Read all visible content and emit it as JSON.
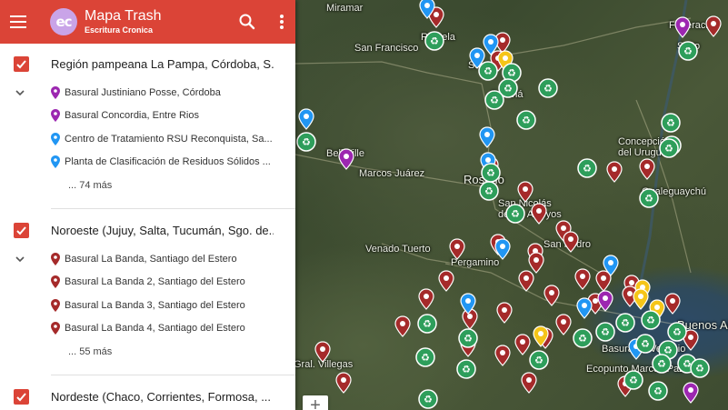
{
  "app": {
    "title": "Mapa Trash",
    "subtitle": "Escritura Cronica",
    "logo_text": "ec",
    "accent_color": "#db4437"
  },
  "header": {
    "menu_icon": "menu-icon",
    "search_icon": "search-icon",
    "more_icon": "more-vert-icon"
  },
  "layers": [
    {
      "title": "Región pampeana La Pampa, Córdoba, S...",
      "checked": true,
      "items": [
        {
          "label": "Basural Justiniano Posse, Córdoba",
          "color": "#9c27b0"
        },
        {
          "label": "Basural Concordia, Entre Rios",
          "color": "#9c27b0"
        },
        {
          "label": "Centro de Tratamiento RSU Reconquista, Sa...",
          "color": "#2196f3"
        },
        {
          "label": "Planta de Clasificación de Residuos Sólidos ...",
          "color": "#2196f3"
        }
      ],
      "more": "... 74 más"
    },
    {
      "title": "Noroeste (Jujuy, Salta, Tucumán, Sgo. de...",
      "checked": true,
      "items": [
        {
          "label": "Basural La Banda, Santiago del Estero",
          "color": "#a52a2a"
        },
        {
          "label": "Basural La Banda 2, Santiago del Estero",
          "color": "#a52a2a"
        },
        {
          "label": "Basural La Banda 3, Santiago del Estero",
          "color": "#a52a2a"
        },
        {
          "label": "Basural La Banda 4, Santiago del Estero",
          "color": "#a52a2a"
        }
      ],
      "more": "... 55 más"
    },
    {
      "title": "Nordeste (Chaco, Corrientes, Formosa, ...",
      "checked": true,
      "items": [],
      "more": ""
    }
  ],
  "map": {
    "places": [
      "Miramar",
      "San Francisco",
      "Santa Fe",
      "Rafaela",
      "Paraná",
      "Bell Ville",
      "Marcos Juárez",
      "Rosario",
      "San Nicolás de los Arroyos",
      "Venado Tuerto",
      "San Pedro",
      "Pergamino",
      "Federación",
      "Salto",
      "Concepción del Uruguay",
      "Gualeguaychú",
      "Buenos Aires",
      "Basural El Vesubio",
      "Ecopunto Marcos Paz",
      "Gral. Villegas"
    ],
    "zoom_in_label": "+"
  }
}
